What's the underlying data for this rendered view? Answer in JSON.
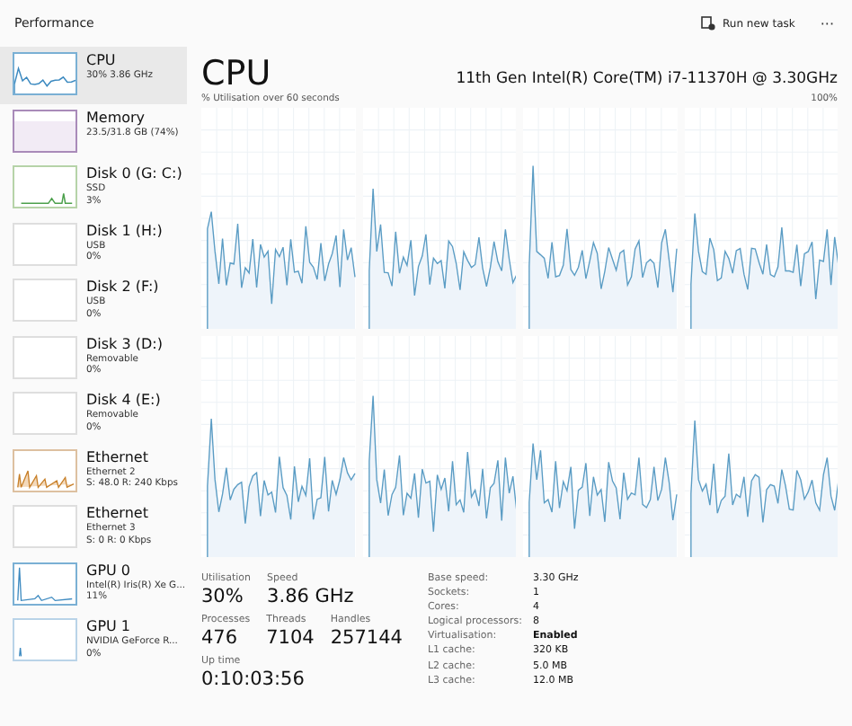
{
  "header": {
    "title": "Performance",
    "run_task": "Run new task",
    "more": "···"
  },
  "sidebar": {
    "items": [
      {
        "kind": "cpu",
        "name": "CPU",
        "lines": [
          "30%  3.86 GHz"
        ],
        "selected": true
      },
      {
        "kind": "memory",
        "name": "Memory",
        "lines": [
          "23.5/31.8 GB (74%)"
        ],
        "selected": false
      },
      {
        "kind": "disk",
        "name": "Disk 0 (G: C:)",
        "lines": [
          "SSD",
          "3%"
        ],
        "selected": false
      },
      {
        "kind": "empty",
        "name": "Disk 1 (H:)",
        "lines": [
          "USB",
          "0%"
        ],
        "selected": false
      },
      {
        "kind": "empty",
        "name": "Disk 2 (F:)",
        "lines": [
          "USB",
          "0%"
        ],
        "selected": false
      },
      {
        "kind": "empty",
        "name": "Disk 3 (D:)",
        "lines": [
          "Removable",
          "0%"
        ],
        "selected": false
      },
      {
        "kind": "empty",
        "name": "Disk 4 (E:)",
        "lines": [
          "Removable",
          "0%"
        ],
        "selected": false
      },
      {
        "kind": "ethernet",
        "name": "Ethernet",
        "lines": [
          "Ethernet 2",
          "S: 48.0 R: 240 Kbps"
        ],
        "selected": false
      },
      {
        "kind": "empty",
        "name": "Ethernet",
        "lines": [
          "Ethernet 3",
          "S: 0 R: 0 Kbps"
        ],
        "selected": false
      },
      {
        "kind": "gpu",
        "name": "GPU 0",
        "lines": [
          "Intel(R) Iris(R) Xe G...",
          "11%"
        ],
        "selected": false
      },
      {
        "kind": "gpu-idle",
        "name": "GPU 1",
        "lines": [
          "NVIDIA GeForce R...",
          "0%"
        ],
        "selected": false
      }
    ]
  },
  "main": {
    "title": "CPU",
    "processor": "11th Gen Intel(R) Core(TM) i7-11370H @ 3.30GHz",
    "graph_caption": "% Utilisation over 60 seconds",
    "graph_max": "100%",
    "stat_rows": [
      [
        {
          "label": "Utilisation",
          "value": "30%"
        },
        {
          "label": "Speed",
          "value": "3.86 GHz"
        }
      ],
      [
        {
          "label": "Processes",
          "value": "476"
        },
        {
          "label": "Threads",
          "value": "7104"
        },
        {
          "label": "Handles",
          "value": "257144"
        }
      ],
      [
        {
          "label": "Up time",
          "value": "0:10:03:56"
        }
      ]
    ],
    "specs": [
      {
        "label": "Base speed:",
        "value": "3.30 GHz"
      },
      {
        "label": "Sockets:",
        "value": "1"
      },
      {
        "label": "Cores:",
        "value": "4"
      },
      {
        "label": "Logical processors:",
        "value": "8"
      },
      {
        "label": "Virtualisation:",
        "value": "Enabled",
        "emphasis": true
      },
      {
        "label": "L1 cache:",
        "value": "320 KB"
      },
      {
        "label": "L2 cache:",
        "value": "5.0 MB"
      },
      {
        "label": "L3 cache:",
        "value": "12.0 MB"
      }
    ]
  }
}
